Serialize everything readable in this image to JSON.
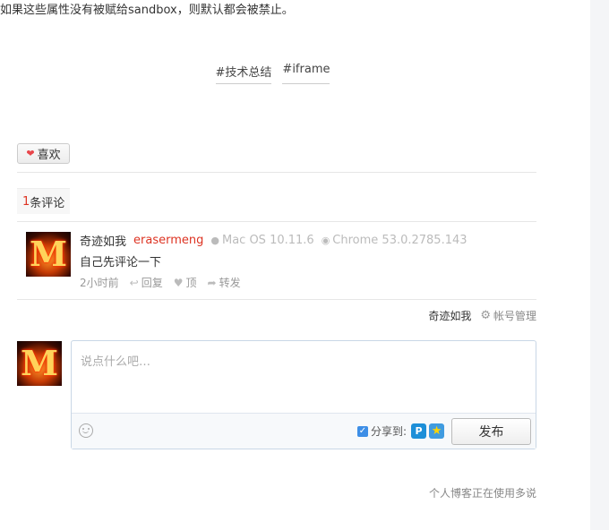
{
  "article": {
    "intro_text": "如果这些属性没有被赋给sandbox，则默认都会被禁止。",
    "tags": [
      "#技术总结",
      "#iframe"
    ]
  },
  "like": {
    "icon": "heart-icon",
    "label": "喜欢"
  },
  "comments": {
    "count": "1",
    "count_suffix": "条评论",
    "items": [
      {
        "author": "奇迹如我",
        "reply_to": "erasermeng",
        "os": "Mac OS 10.11.6",
        "browser": "Chrome 53.0.2785.143",
        "text": "自己先评论一下",
        "time": "2小时前",
        "reply_label": "回复",
        "upvote_label": "顶",
        "share_label": "转发"
      }
    ]
  },
  "account": {
    "username": "奇迹如我",
    "manage_label": "帐号管理"
  },
  "composer": {
    "placeholder": "说点什么吧…",
    "share_label": "分享到:",
    "share_checked": true,
    "publish_label": "发布"
  },
  "footer": {
    "text": "个人博客正在使用多说"
  },
  "colors": {
    "accent_red": "#dd3322",
    "checkbox_blue": "#3d8ee6",
    "border_blue": "#c9d7e6"
  }
}
